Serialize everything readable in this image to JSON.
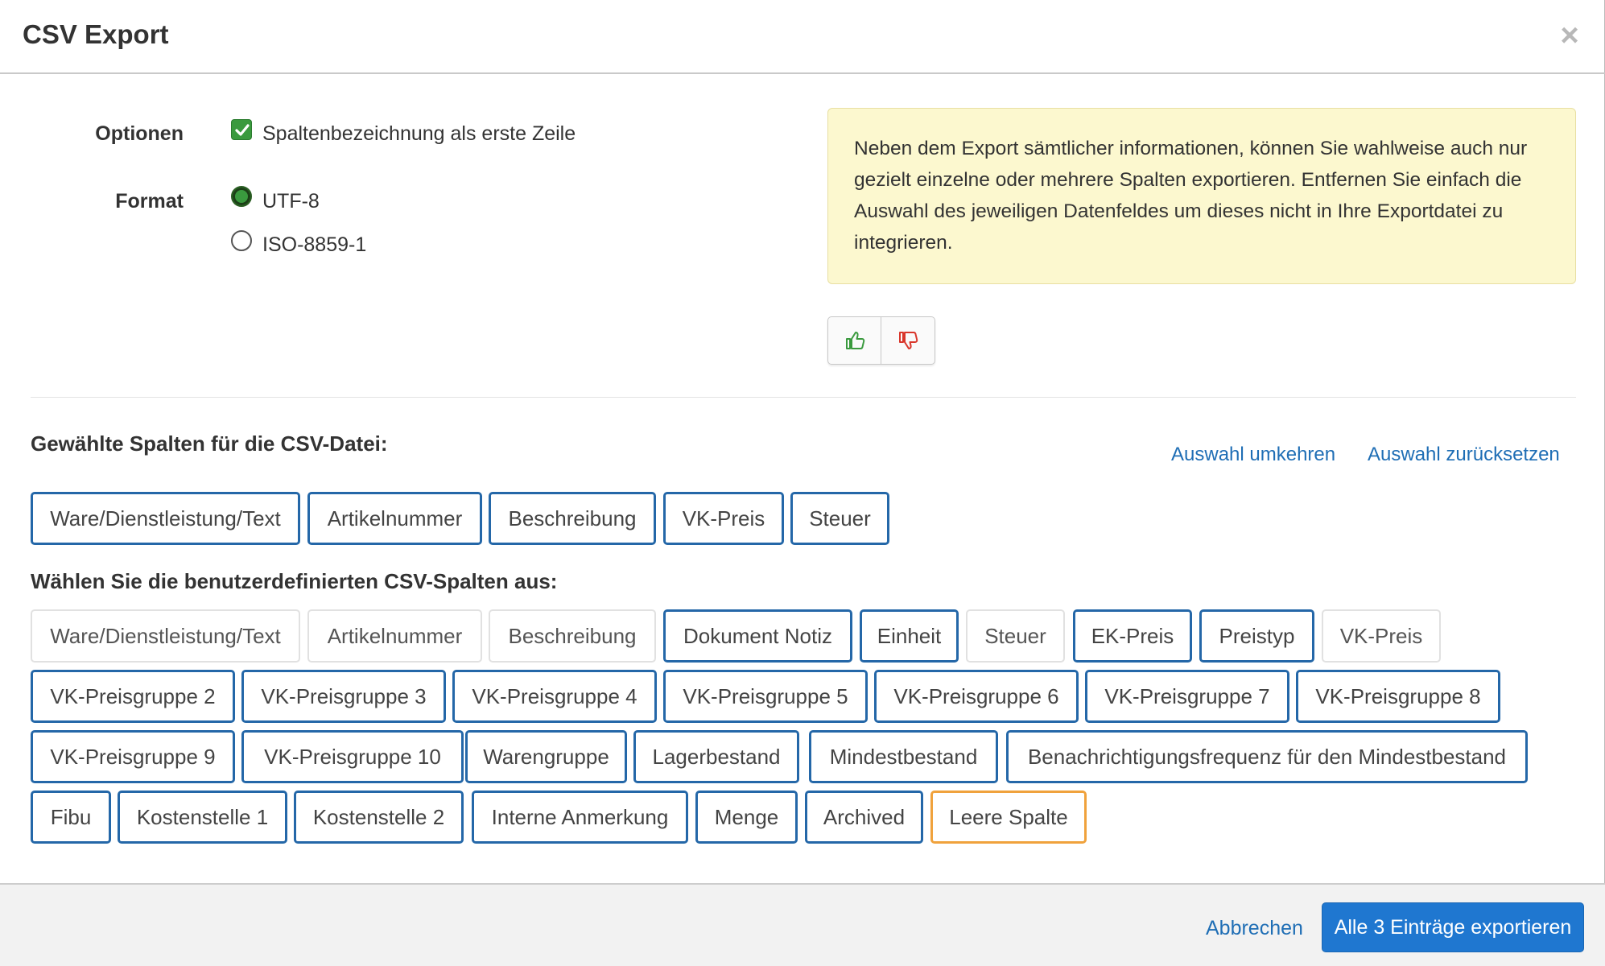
{
  "dialog": {
    "title": "CSV Export",
    "close_icon": "×"
  },
  "options": {
    "label": "Optionen",
    "header_row_label": "Spaltenbezeichnung als erste Zeile",
    "header_row_checked": true
  },
  "format": {
    "label": "Format",
    "choices": [
      {
        "label": "UTF-8",
        "selected": true
      },
      {
        "label": "ISO-8859-1",
        "selected": false
      }
    ]
  },
  "info": {
    "text": "Neben dem Export sämtlicher informationen, können Sie wahlweise auch nur gezielt einzelne oder mehrere Spalten exportieren. Entfernen Sie einfach die Auswahl des jeweiligen Datenfeldes um dieses nicht in Ihre Exportdatei zu integrieren.",
    "thumbs_up_icon": "thumbs-up-icon",
    "thumbs_down_icon": "thumbs-down-icon"
  },
  "selected_columns": {
    "title": "Gewählte Spalten für die CSV-Datei:",
    "invert_label": "Auswahl umkehren",
    "reset_label": "Auswahl zurücksetzen",
    "items": [
      "Ware/Dienstleistung/Text",
      "Artikelnummer",
      "Beschreibung",
      "VK-Preis",
      "Steuer"
    ]
  },
  "custom_columns": {
    "title": "Wählen Sie die benutzerdefinierten CSV-Spalten aus:",
    "items": [
      {
        "label": "Ware/Dienstleistung/Text",
        "state": "inactive"
      },
      {
        "label": "Artikelnummer",
        "state": "inactive"
      },
      {
        "label": "Beschreibung",
        "state": "inactive"
      },
      {
        "label": "Dokument Notiz",
        "state": "active"
      },
      {
        "label": "Einheit",
        "state": "active"
      },
      {
        "label": "Steuer",
        "state": "inactive"
      },
      {
        "label": "EK-Preis",
        "state": "active"
      },
      {
        "label": "Preistyp",
        "state": "active"
      },
      {
        "label": "VK-Preis",
        "state": "inactive"
      },
      {
        "label": "VK-Preisgruppe 2",
        "state": "active"
      },
      {
        "label": "VK-Preisgruppe 3",
        "state": "active"
      },
      {
        "label": "VK-Preisgruppe 4",
        "state": "active"
      },
      {
        "label": "VK-Preisgruppe 5",
        "state": "active"
      },
      {
        "label": "VK-Preisgruppe 6",
        "state": "active"
      },
      {
        "label": "VK-Preisgruppe 7",
        "state": "active"
      },
      {
        "label": "VK-Preisgruppe 8",
        "state": "active"
      },
      {
        "label": "VK-Preisgruppe 9",
        "state": "active"
      },
      {
        "label": "VK-Preisgruppe 10",
        "state": "active"
      },
      {
        "label": "Warengruppe",
        "state": "active"
      },
      {
        "label": "Lagerbestand",
        "state": "active"
      },
      {
        "label": "Mindestbestand",
        "state": "active"
      },
      {
        "label": "Benachrichtigungsfrequenz für den Mindestbestand",
        "state": "active"
      },
      {
        "label": "Fibu",
        "state": "active"
      },
      {
        "label": "Kostenstelle 1",
        "state": "active"
      },
      {
        "label": "Kostenstelle 2",
        "state": "active"
      },
      {
        "label": "Interne Anmerkung",
        "state": "active"
      },
      {
        "label": "Menge",
        "state": "active"
      },
      {
        "label": "Archived",
        "state": "active"
      },
      {
        "label": "Leere Spalte",
        "state": "empty"
      }
    ]
  },
  "footer": {
    "cancel_label": "Abbrechen",
    "export_label": "Alle 3 Einträge exportieren"
  },
  "colors": {
    "accent": "#2467a8",
    "primary_button": "#1f77d0",
    "link": "#1f6eb5",
    "checkbox": "#3a9a3e",
    "info_bg": "#fcf8cf",
    "empty_column_border": "#f0a23c",
    "thumbs_up": "#3a9a3e",
    "thumbs_down": "#d9362b"
  }
}
